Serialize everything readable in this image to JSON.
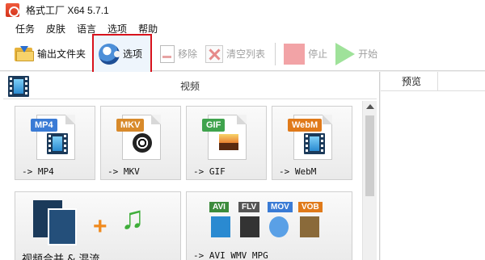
{
  "window": {
    "title": "格式工厂 X64 5.7.1"
  },
  "menu": [
    "任务",
    "皮肤",
    "语言",
    "选项",
    "帮助"
  ],
  "toolbar": {
    "output_folder": "输出文件夹",
    "options": "选项",
    "remove": "移除",
    "clear_list": "清空列表",
    "stop": "停止",
    "start": "开始"
  },
  "category": {
    "title": "视频"
  },
  "formats": [
    {
      "tag": "MP4",
      "label": "-> MP4"
    },
    {
      "tag": "MKV",
      "label": "-> MKV"
    },
    {
      "tag": "GIF",
      "label": "-> GIF"
    },
    {
      "tag": "WebM",
      "label": "-> WebM"
    }
  ],
  "tools": {
    "merge_label": "视频合并 & 混流",
    "multi_label": "-> AVI WMV MPG",
    "multi_tags": [
      "AVI",
      "FLV",
      "MOV",
      "VOB"
    ]
  },
  "preview": {
    "header": "预览"
  },
  "colors": {
    "mp4_tag": "#3a7bd5",
    "mkv_tag": "#d88a2b",
    "gif_tag": "#3fa34d",
    "webm_tag": "#e07a1a",
    "highlight_border": "#d8121c"
  }
}
